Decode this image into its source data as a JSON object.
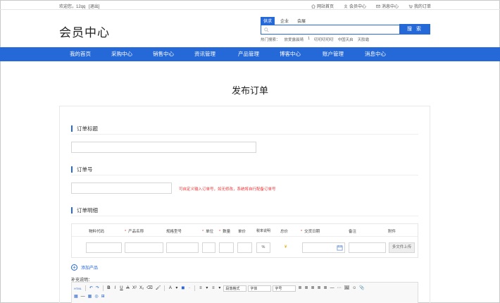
{
  "topbar": {
    "welcome": "欢迎您，12qq",
    "logout": "[退出]",
    "links": [
      {
        "label": "网站首页",
        "icon": "home-icon"
      },
      {
        "label": "会员中心",
        "icon": "user-icon"
      },
      {
        "label": "消息中心",
        "icon": "mail-icon"
      },
      {
        "label": "我的订单",
        "icon": "cart-icon"
      }
    ]
  },
  "header": {
    "logo": "会员中心",
    "search_tabs": [
      "供求",
      "企业",
      "会展"
    ],
    "search_placeholder": "",
    "search_button": "搜 索",
    "hot_label": "热门搜索：",
    "hot_terms": [
      "放爱露晨晴",
      "1",
      "叨叨叨叨叨",
      "中国天启",
      "天胶霜"
    ]
  },
  "nav": [
    "我的首页",
    "采购中心",
    "销售中心",
    "资讯管理",
    "产品管理",
    "博客中心",
    "账户管理",
    "消息中心"
  ],
  "page": {
    "title": "发布订单",
    "section_title": "订单标题",
    "section_number": "订单号",
    "number_hint": "可自定义输入订单号，如无修改，系统将自行配备订单号",
    "section_detail": "订单明细",
    "add_product": "添加产品",
    "supplement": "补充说明："
  },
  "table": {
    "headers": [
      {
        "label": "物料代码",
        "required": false
      },
      {
        "label": "产品名称",
        "required": true
      },
      {
        "label": "规格型号",
        "required": false
      },
      {
        "label": "单位",
        "required": true
      },
      {
        "label": "数量",
        "required": true
      },
      {
        "label": "单价",
        "required": false
      },
      {
        "label": "税率说明",
        "required": false
      },
      {
        "label": "总价",
        "required": false
      },
      {
        "label": "交货日期",
        "required": true
      },
      {
        "label": "备注",
        "required": false
      },
      {
        "label": "附件",
        "required": false
      }
    ],
    "rate_unit": "%",
    "total_star": "¥",
    "upload_label": "多文件上传"
  },
  "editor": {
    "row1": [
      "HTML",
      "↶",
      "↷",
      "B",
      "I",
      "U",
      "A",
      "X²",
      "X₂",
      "⌫",
      "🖌",
      "A",
      "▾",
      "◼",
      "∙",
      "≡",
      "▾",
      "≡",
      "▾",
      "段落格式",
      "字体",
      "字号",
      "≣",
      "≣",
      "≣",
      "≣",
      "≣",
      "—",
      "⋯",
      "🖼",
      "☺",
      "📎"
    ],
    "row2": [
      "▦",
      "—",
      "▦",
      "◎",
      "⊞"
    ]
  }
}
